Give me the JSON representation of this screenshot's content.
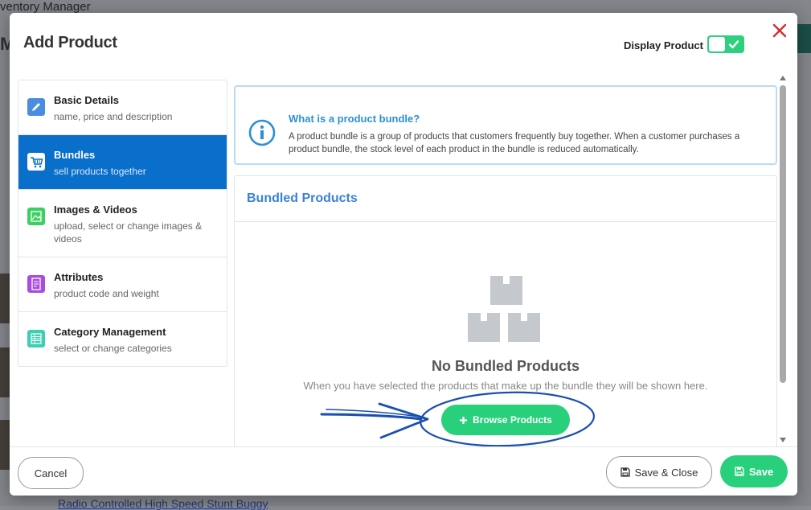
{
  "background": {
    "app_title": "ventory Manager",
    "bottom_link": "Radio Controlled High Speed Stunt Buggy"
  },
  "modal": {
    "title": "Add Product",
    "display_product_label": "Display Product",
    "display_product_on": true
  },
  "sidebar": {
    "items": [
      {
        "title": "Basic Details",
        "subtitle": "name, price and description",
        "icon": "pencil-icon",
        "color": "#4a8de0"
      },
      {
        "title": "Bundles",
        "subtitle": "sell products together",
        "icon": "cart-icon",
        "color": "#ffffff"
      },
      {
        "title": "Images & Videos",
        "subtitle": "upload, select or change images & videos",
        "icon": "image-icon",
        "color": "#3ccf63"
      },
      {
        "title": "Attributes",
        "subtitle": "product code and weight",
        "icon": "document-icon",
        "color": "#a74de0"
      },
      {
        "title": "Category Management",
        "subtitle": "select or change categories",
        "icon": "list-icon",
        "color": "#3dcfb0"
      }
    ],
    "active_index": 1
  },
  "info": {
    "title": "What is a product bundle?",
    "text": "A product bundle is a group of products that customers frequently buy together. When a customer purchases a product bundle, the stock level of each product in the bundle is reduced automatically."
  },
  "bundled_products": {
    "header": "Bundled Products",
    "empty_title": "No Bundled Products",
    "empty_subtitle": "When you have selected the products that make up the bundle they will be shown here.",
    "browse_label": "Browse Products"
  },
  "footer": {
    "cancel_label": "Cancel",
    "save_close_label": "Save & Close",
    "save_label": "Save"
  },
  "colors": {
    "accent_green": "#29d07b",
    "active_blue": "#0a6fca",
    "heading_blue": "#3b82d6",
    "close_red": "#d32f2f"
  }
}
